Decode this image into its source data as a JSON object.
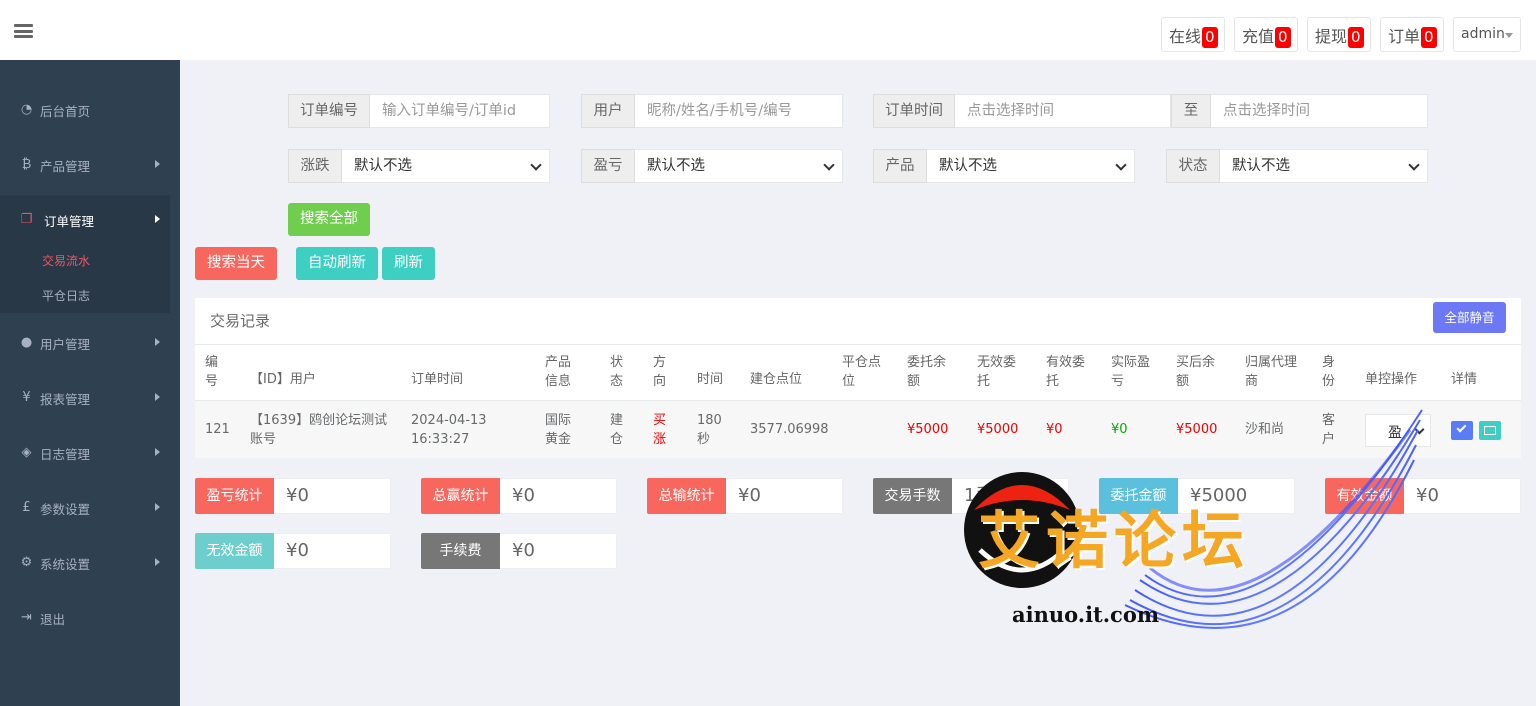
{
  "topbar": {
    "stats": [
      {
        "label": "在线",
        "count": "0"
      },
      {
        "label": "充值",
        "count": "0"
      },
      {
        "label": "提现",
        "count": "0"
      },
      {
        "label": "订单",
        "count": "0"
      }
    ],
    "user": "admin"
  },
  "sidebar": {
    "items": [
      {
        "label": "后台首页",
        "icon": "dashboard-icon"
      },
      {
        "label": "产品管理",
        "icon": "bitcoin-icon"
      },
      {
        "label": "订单管理",
        "icon": "copy-icon"
      },
      {
        "label": "用户管理",
        "icon": "user-icon"
      },
      {
        "label": "报表管理",
        "icon": "yen-icon"
      },
      {
        "label": "日志管理",
        "icon": "tag-icon"
      },
      {
        "label": "参数设置",
        "icon": "pound-icon"
      },
      {
        "label": "系统设置",
        "icon": "gears-icon"
      },
      {
        "label": "退出",
        "icon": "sign-out-icon"
      }
    ],
    "sub_items": [
      "交易流水",
      "平仓日志"
    ]
  },
  "filters": {
    "order_no": {
      "label": "订单编号",
      "placeholder": "输入订单编号/订单id"
    },
    "user": {
      "label": "用户",
      "placeholder": "昵称/姓名/手机号/编号"
    },
    "order_time": {
      "label": "订单时间",
      "placeholder": "点击选择时间"
    },
    "to": {
      "label": "至",
      "placeholder": "点击选择时间"
    },
    "rise_fall": {
      "label": "涨跌",
      "value": "默认不选"
    },
    "profit_loss": {
      "label": "盈亏",
      "value": "默认不选"
    },
    "product": {
      "label": "产品",
      "value": "默认不选"
    },
    "status": {
      "label": "状态",
      "value": "默认不选"
    }
  },
  "buttons": {
    "search_all": "搜索全部",
    "search_today": "搜索当天",
    "auto_refresh": "自动刷新",
    "refresh": "刷新",
    "mute_all": "全部静音"
  },
  "table": {
    "title": "交易记录",
    "headers": [
      "编号",
      "【ID】用户",
      "订单时间",
      "产品信息",
      "状态",
      "方向",
      "时间",
      "建仓点位",
      "平仓点位",
      "委托余额",
      "无效委托",
      "有效委托",
      "实际盈亏",
      "买后余额",
      "归属代理商",
      "身份",
      "单控操作",
      "详情"
    ],
    "rows": [
      {
        "id": "121",
        "user": "【1639】鸥创论坛测试账号",
        "time": "2024-04-13 16:33:27",
        "product": "国际黄金",
        "status": "建仓",
        "direction": "买涨",
        "duration": "180秒",
        "open_price": "3577.06998",
        "close_price": "",
        "entrust": "¥5000",
        "invalid": "¥5000",
        "valid": "¥0",
        "pnl": "¥0",
        "balance_after": "¥5000",
        "agent": "沙和尚",
        "role": "客户",
        "control": "盈"
      }
    ]
  },
  "stats": {
    "profit_loss": {
      "label": "盈亏统计",
      "value": "¥0"
    },
    "total_win": {
      "label": "总赢统计",
      "value": "¥0"
    },
    "total_loss": {
      "label": "总输统计",
      "value": "¥0"
    },
    "trade_lots": {
      "label": "交易手数",
      "value": "1手"
    },
    "entrust_amount": {
      "label": "委托金额",
      "value": "¥5000"
    },
    "valid_amount": {
      "label": "有效金额",
      "value": "¥0"
    },
    "invalid_amount": {
      "label": "无效金额",
      "value": "¥0"
    },
    "fee": {
      "label": "手续费",
      "value": "¥0"
    }
  },
  "watermark": {
    "text": "艾诺论坛",
    "url": "ainuo.it.com"
  },
  "colors": {
    "sidebar": "#2f4050",
    "red_btn": "#f8675e",
    "teal_btn": "#3ccfc2",
    "green_btn": "#6fce4e",
    "accent_blue": "#6d78f5"
  }
}
